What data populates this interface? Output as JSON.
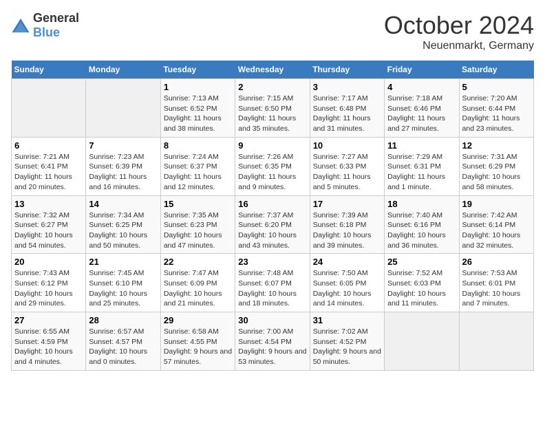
{
  "logo": {
    "text_general": "General",
    "text_blue": "Blue"
  },
  "title": {
    "month": "October 2024",
    "location": "Neuenmarkt, Germany"
  },
  "days_of_week": [
    "Sunday",
    "Monday",
    "Tuesday",
    "Wednesday",
    "Thursday",
    "Friday",
    "Saturday"
  ],
  "weeks": [
    [
      {
        "day": "",
        "info": ""
      },
      {
        "day": "",
        "info": ""
      },
      {
        "day": "1",
        "info": "Sunrise: 7:13 AM\nSunset: 6:52 PM\nDaylight: 11 hours and 38 minutes."
      },
      {
        "day": "2",
        "info": "Sunrise: 7:15 AM\nSunset: 6:50 PM\nDaylight: 11 hours and 35 minutes."
      },
      {
        "day": "3",
        "info": "Sunrise: 7:17 AM\nSunset: 6:48 PM\nDaylight: 11 hours and 31 minutes."
      },
      {
        "day": "4",
        "info": "Sunrise: 7:18 AM\nSunset: 6:46 PM\nDaylight: 11 hours and 27 minutes."
      },
      {
        "day": "5",
        "info": "Sunrise: 7:20 AM\nSunset: 6:44 PM\nDaylight: 11 hours and 23 minutes."
      }
    ],
    [
      {
        "day": "6",
        "info": "Sunrise: 7:21 AM\nSunset: 6:41 PM\nDaylight: 11 hours and 20 minutes."
      },
      {
        "day": "7",
        "info": "Sunrise: 7:23 AM\nSunset: 6:39 PM\nDaylight: 11 hours and 16 minutes."
      },
      {
        "day": "8",
        "info": "Sunrise: 7:24 AM\nSunset: 6:37 PM\nDaylight: 11 hours and 12 minutes."
      },
      {
        "day": "9",
        "info": "Sunrise: 7:26 AM\nSunset: 6:35 PM\nDaylight: 11 hours and 9 minutes."
      },
      {
        "day": "10",
        "info": "Sunrise: 7:27 AM\nSunset: 6:33 PM\nDaylight: 11 hours and 5 minutes."
      },
      {
        "day": "11",
        "info": "Sunrise: 7:29 AM\nSunset: 6:31 PM\nDaylight: 11 hours and 1 minute."
      },
      {
        "day": "12",
        "info": "Sunrise: 7:31 AM\nSunset: 6:29 PM\nDaylight: 10 hours and 58 minutes."
      }
    ],
    [
      {
        "day": "13",
        "info": "Sunrise: 7:32 AM\nSunset: 6:27 PM\nDaylight: 10 hours and 54 minutes."
      },
      {
        "day": "14",
        "info": "Sunrise: 7:34 AM\nSunset: 6:25 PM\nDaylight: 10 hours and 50 minutes."
      },
      {
        "day": "15",
        "info": "Sunrise: 7:35 AM\nSunset: 6:23 PM\nDaylight: 10 hours and 47 minutes."
      },
      {
        "day": "16",
        "info": "Sunrise: 7:37 AM\nSunset: 6:20 PM\nDaylight: 10 hours and 43 minutes."
      },
      {
        "day": "17",
        "info": "Sunrise: 7:39 AM\nSunset: 6:18 PM\nDaylight: 10 hours and 39 minutes."
      },
      {
        "day": "18",
        "info": "Sunrise: 7:40 AM\nSunset: 6:16 PM\nDaylight: 10 hours and 36 minutes."
      },
      {
        "day": "19",
        "info": "Sunrise: 7:42 AM\nSunset: 6:14 PM\nDaylight: 10 hours and 32 minutes."
      }
    ],
    [
      {
        "day": "20",
        "info": "Sunrise: 7:43 AM\nSunset: 6:12 PM\nDaylight: 10 hours and 29 minutes."
      },
      {
        "day": "21",
        "info": "Sunrise: 7:45 AM\nSunset: 6:10 PM\nDaylight: 10 hours and 25 minutes."
      },
      {
        "day": "22",
        "info": "Sunrise: 7:47 AM\nSunset: 6:09 PM\nDaylight: 10 hours and 21 minutes."
      },
      {
        "day": "23",
        "info": "Sunrise: 7:48 AM\nSunset: 6:07 PM\nDaylight: 10 hours and 18 minutes."
      },
      {
        "day": "24",
        "info": "Sunrise: 7:50 AM\nSunset: 6:05 PM\nDaylight: 10 hours and 14 minutes."
      },
      {
        "day": "25",
        "info": "Sunrise: 7:52 AM\nSunset: 6:03 PM\nDaylight: 10 hours and 11 minutes."
      },
      {
        "day": "26",
        "info": "Sunrise: 7:53 AM\nSunset: 6:01 PM\nDaylight: 10 hours and 7 minutes."
      }
    ],
    [
      {
        "day": "27",
        "info": "Sunrise: 6:55 AM\nSunset: 4:59 PM\nDaylight: 10 hours and 4 minutes."
      },
      {
        "day": "28",
        "info": "Sunrise: 6:57 AM\nSunset: 4:57 PM\nDaylight: 10 hours and 0 minutes."
      },
      {
        "day": "29",
        "info": "Sunrise: 6:58 AM\nSunset: 4:55 PM\nDaylight: 9 hours and 57 minutes."
      },
      {
        "day": "30",
        "info": "Sunrise: 7:00 AM\nSunset: 4:54 PM\nDaylight: 9 hours and 53 minutes."
      },
      {
        "day": "31",
        "info": "Sunrise: 7:02 AM\nSunset: 4:52 PM\nDaylight: 9 hours and 50 minutes."
      },
      {
        "day": "",
        "info": ""
      },
      {
        "day": "",
        "info": ""
      }
    ]
  ]
}
